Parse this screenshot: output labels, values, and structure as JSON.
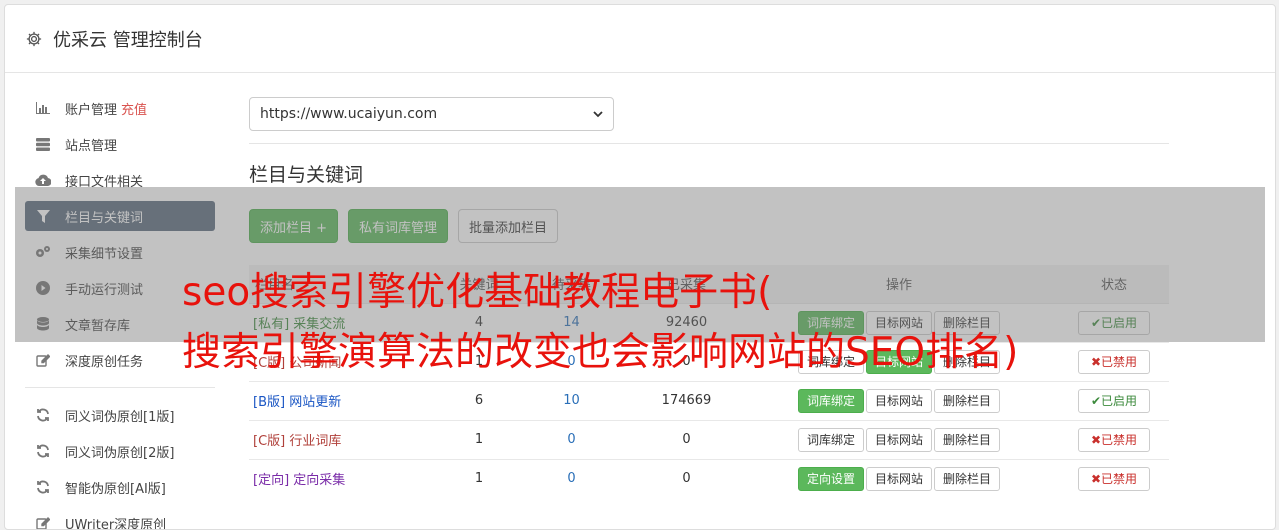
{
  "header": {
    "title": "优采云 管理控制台",
    "icon": "gear-icon"
  },
  "sidebar": {
    "items": [
      {
        "label": "账户管理",
        "extra": "充值",
        "icon": "bar-chart-icon"
      },
      {
        "label": "站点管理",
        "icon": "server-icon"
      },
      {
        "label": "接口文件相关",
        "icon": "cloud-upload-icon"
      },
      {
        "label": "栏目与关键词",
        "icon": "filter-icon",
        "active": true
      },
      {
        "label": "采集细节设置",
        "icon": "cogs-icon"
      },
      {
        "label": "手动运行测试",
        "icon": "play-circle-icon"
      },
      {
        "label": "文章暂存库",
        "icon": "database-icon"
      },
      {
        "label": "深度原创任务",
        "icon": "edit-icon"
      },
      {
        "label": "同义词伪原创[1版]",
        "icon": "refresh-icon"
      },
      {
        "label": "同义词伪原创[2版]",
        "icon": "refresh-icon"
      },
      {
        "label": "智能伪原创[AI版]",
        "icon": "refresh-icon"
      },
      {
        "label": "UWriter深度原创",
        "icon": "edit-icon"
      }
    ]
  },
  "main": {
    "site_select": "https://www.ucaiyun.com",
    "section_title": "栏目与关键词",
    "buttons": {
      "add_column": "添加栏目 +",
      "private_lib": "私有词库管理",
      "batch_add": "批量添加栏目"
    },
    "table": {
      "headers": {
        "name": "栏目名",
        "c1": "关键词",
        "c2": "待采集",
        "c3": "已采集",
        "ops": "操作",
        "status": "状态"
      },
      "rows": [
        {
          "tag": "[私有]",
          "name": "采集交流",
          "c1": "4",
          "c2": "14",
          "c3": "92460",
          "op1": "词库绑定",
          "op2": "目标网站",
          "op3": "删除栏目",
          "status": "已启用"
        },
        {
          "tag": "[C版]",
          "name": "公司新闻",
          "c1": "1",
          "c2": "0",
          "c3": "0",
          "op1": "词库绑定",
          "op2": "目标网站",
          "op3": "删除栏目",
          "status": "已禁用"
        },
        {
          "tag": "[B版]",
          "name": "网站更新",
          "c1": "6",
          "c2": "10",
          "c3": "174669",
          "op1": "词库绑定",
          "op2": "目标网站",
          "op3": "删除栏目",
          "status": "已启用"
        },
        {
          "tag": "[C版]",
          "name": "行业词库",
          "c1": "1",
          "c2": "0",
          "c3": "0",
          "op1": "词库绑定",
          "op2": "目标网站",
          "op3": "删除栏目",
          "status": "已禁用"
        },
        {
          "tag": "[定向]",
          "name": "定向采集",
          "c1": "1",
          "c2": "0",
          "c3": "0",
          "op1": "定向设置",
          "op2": "目标网站",
          "op3": "删除栏目",
          "status": "已禁用"
        }
      ]
    }
  },
  "overlay": {
    "line1": "seo搜索引擎优化基础教程电子书(",
    "line2": "搜索引擎演算法的改变也会影响网站的SEO排名)"
  }
}
